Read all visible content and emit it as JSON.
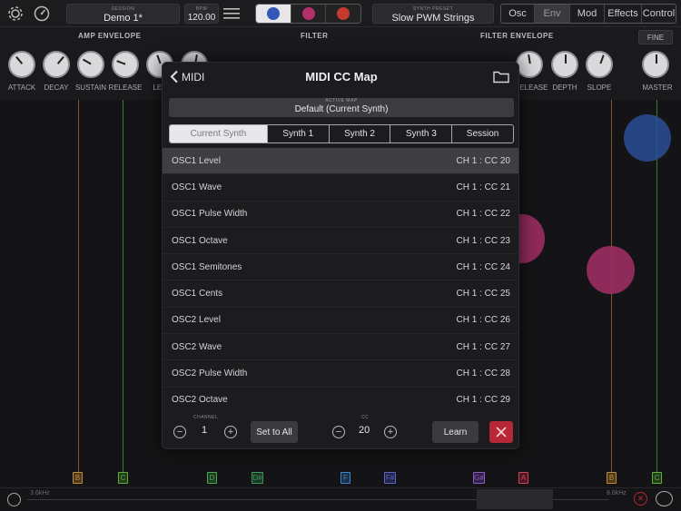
{
  "topbar": {
    "session_label": "SESSION",
    "session_value": "Demo 1*",
    "bpm_label": "BPM",
    "bpm_value": "120.00",
    "preset_label": "SYNTH PRESET",
    "preset_value": "Slow PWM Strings",
    "synth_colors": [
      "#3558b8",
      "#b3306d",
      "#c6392d"
    ],
    "nav_tabs": [
      "Osc",
      "Env",
      "Mod",
      "Effects",
      "Control"
    ],
    "active_nav": "Env"
  },
  "panel": {
    "sections": [
      "AMP ENVELOPE",
      "FILTER",
      "FILTER ENVELOPE"
    ],
    "amp_knobs": [
      "ATTACK",
      "DECAY",
      "SUSTAIN",
      "RELEASE",
      "LEV"
    ],
    "filter_env_knobs": [
      "RELEASE",
      "DEPTH",
      "SLOPE"
    ],
    "fine_label": "FINE",
    "master_label": "MASTER"
  },
  "modal": {
    "back_label": "MIDI",
    "title": "MIDI CC Map",
    "active_map_label": "ACTIVE MAP",
    "active_map_value": "Default (Current Synth)",
    "tabs": [
      "Current Synth",
      "Synth 1",
      "Synth 2",
      "Synth 3",
      "Session"
    ],
    "rows": [
      {
        "name": "OSC1 Level",
        "cc": "CH 1 : CC 20"
      },
      {
        "name": "OSC1 Wave",
        "cc": "CH 1 : CC 21"
      },
      {
        "name": "OSC1 Pulse Width",
        "cc": "CH 1 : CC 22"
      },
      {
        "name": "OSC1 Octave",
        "cc": "CH 1 : CC 23"
      },
      {
        "name": "OSC1 Semitones",
        "cc": "CH 1 : CC 24"
      },
      {
        "name": "OSC1 Cents",
        "cc": "CH 1 : CC 25"
      },
      {
        "name": "OSC2 Level",
        "cc": "CH 1 : CC 26"
      },
      {
        "name": "OSC2 Wave",
        "cc": "CH 1 : CC 27"
      },
      {
        "name": "OSC2 Pulse Width",
        "cc": "CH 1 : CC 28"
      },
      {
        "name": "OSC2 Octave",
        "cc": "CH 1 : CC 29"
      }
    ],
    "footer": {
      "channel_label": "CHANNEL",
      "channel_value": "1",
      "set_all_label": "Set to All",
      "cc_label": "CC",
      "cc_value": "20",
      "learn_label": "Learn",
      "minus": "−",
      "plus": "+"
    }
  },
  "keyboard": {
    "notes": [
      {
        "label": "B",
        "color": "#c08a3a"
      },
      {
        "label": "C",
        "color": "#5fae3f"
      },
      {
        "label": "D",
        "color": "#4aa84e"
      },
      {
        "label": "D#",
        "color": "#3c9a58"
      },
      {
        "label": "F",
        "color": "#3f86c6"
      },
      {
        "label": "F#",
        "color": "#5a66c8"
      },
      {
        "label": "G#",
        "color": "#8a59c2"
      },
      {
        "label": "A",
        "color": "#d04258"
      },
      {
        "label": "B",
        "color": "#c08a3a"
      },
      {
        "label": "C",
        "color": "#5fae3f"
      }
    ],
    "freq_left": "3.6kHz",
    "freq_right": "8.6kHz"
  }
}
